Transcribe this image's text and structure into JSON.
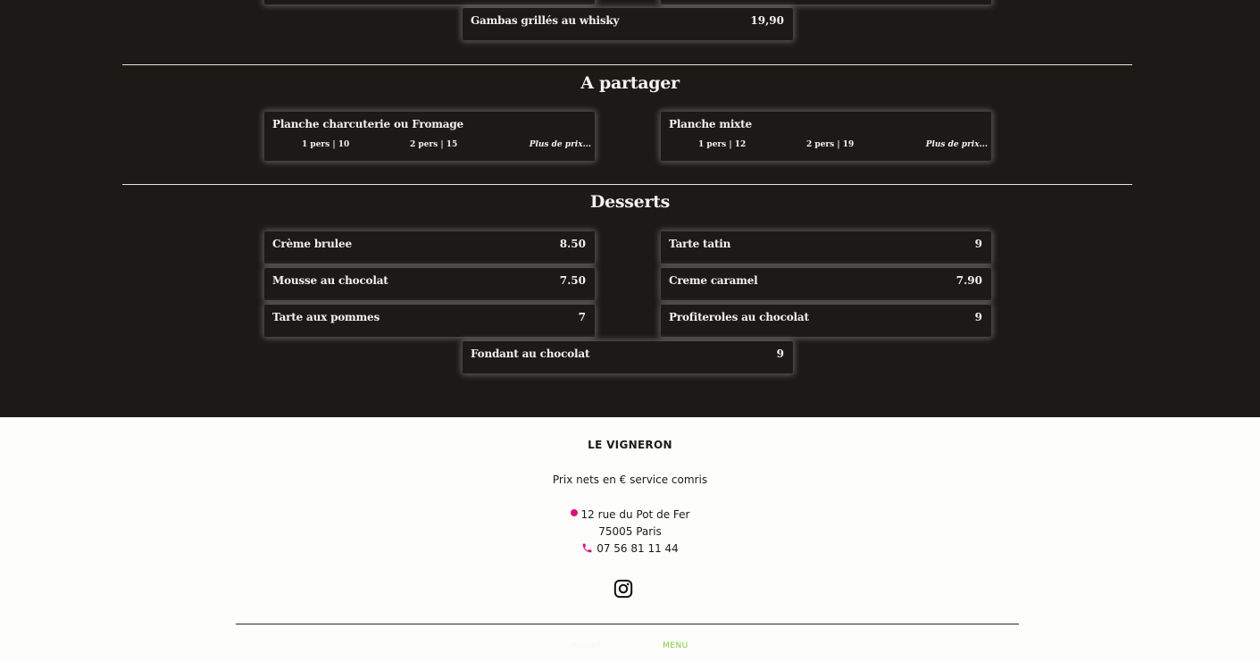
{
  "top_items": [
    {
      "name": "Gambas grillés au whisky",
      "price": "19,90"
    }
  ],
  "sections": {
    "partager": {
      "title": "A partager",
      "items": [
        {
          "name": "Planche charcuterie ou Fromage",
          "opt1": "1 pers | 10",
          "opt2": "2 pers | 15",
          "more": "Plus de prix..."
        },
        {
          "name": "Planche mixte",
          "opt1": "1 pers | 12",
          "opt2": "2 pers | 19",
          "more": "Plus de prix..."
        }
      ]
    },
    "desserts": {
      "title": "Desserts",
      "items": [
        {
          "name": "Crème brulee",
          "price": "8.50"
        },
        {
          "name": "Tarte tatin",
          "price": "9"
        },
        {
          "name": "Mousse au chocolat",
          "price": "7.50"
        },
        {
          "name": "Creme caramel",
          "price": "7.90"
        },
        {
          "name": "Tarte aux pommes",
          "price": "7"
        },
        {
          "name": "Profiteroles au chocolat",
          "price": "9"
        },
        {
          "name": "Fondant au chocolat",
          "price": "9"
        }
      ]
    }
  },
  "footer": {
    "brand": "LE VIGNERON",
    "note": "Prix nets en € service comris",
    "address_line1": "12 rue du Pot de Fer",
    "address_line2": "75005 Paris",
    "phone": "07 56 81 11 44",
    "instagram_icon": "instagram-icon",
    "nav_faint": "Accueil",
    "nav_menu": "MENU",
    "colors": {
      "pin": "#d6157a",
      "phone": "#d6157a",
      "menu_link": "#7ecb3c"
    }
  }
}
